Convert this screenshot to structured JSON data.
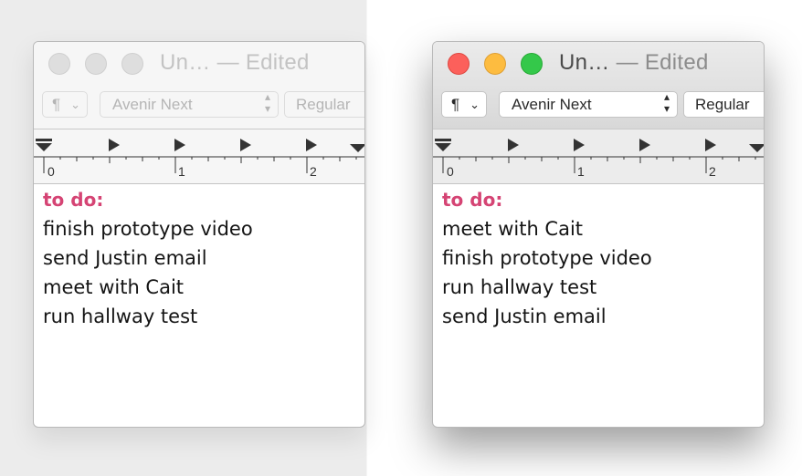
{
  "windows": {
    "left": {
      "title_name": "Un…",
      "title_sep": "—",
      "title_state": "Edited",
      "toolbar": {
        "paragraph_label": "¶",
        "font_family": "Avenir Next",
        "font_style": "Regular"
      },
      "ruler_labels": [
        "0",
        "1",
        "2"
      ],
      "note": {
        "heading": "to do:",
        "items": [
          "finish prototype video",
          "send Justin email",
          "meet with Cait",
          "run hallway test"
        ]
      }
    },
    "right": {
      "title_name": "Un…",
      "title_sep": "—",
      "title_state": "Edited",
      "toolbar": {
        "paragraph_label": "¶",
        "font_family": "Avenir Next",
        "font_style": "Regular"
      },
      "ruler_labels": [
        "0",
        "1",
        "2"
      ],
      "note": {
        "heading": "to do:",
        "items": [
          "meet with Cait",
          "finish prototype video",
          "run hallway test",
          "send Justin email"
        ]
      }
    }
  },
  "colors": {
    "heading_accent": "#d54474",
    "close": "#fc605b",
    "minimize": "#fdbc40",
    "zoom": "#34c84a",
    "inactive_light": "#dedede"
  },
  "icons": [
    "close-icon",
    "minimize-icon",
    "zoom-icon",
    "paragraph-icon",
    "chevron-down-icon",
    "updown-arrows-icon",
    "tab-stop-icon",
    "indent-marker-icon"
  ]
}
